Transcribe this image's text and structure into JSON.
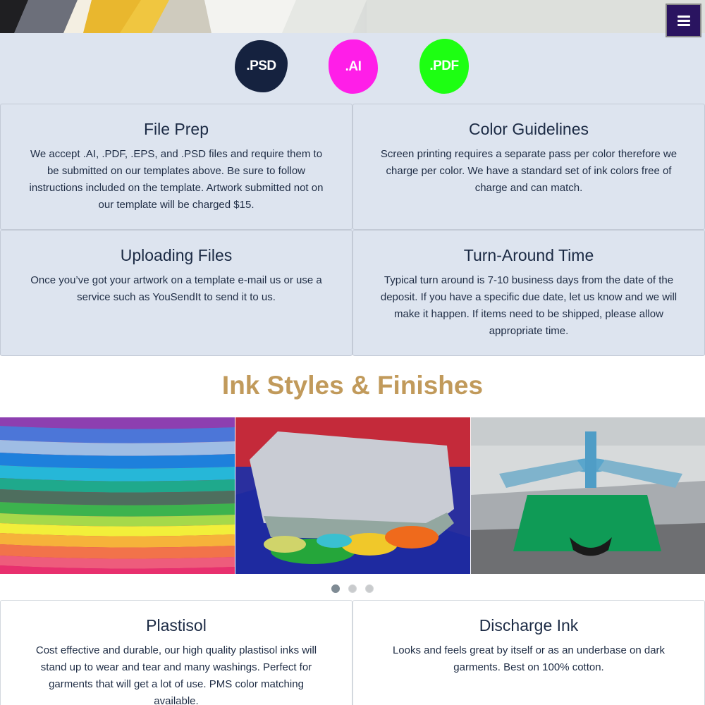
{
  "header": {
    "menu_icon": "hamburger-icon"
  },
  "file_types": [
    {
      "label": ".PSD",
      "color": "#15223f"
    },
    {
      "label": ".AI",
      "color": "#ff1ee8"
    },
    {
      "label": ".PDF",
      "color": "#1dff12"
    }
  ],
  "guidelines": [
    {
      "title": "File Prep",
      "body": "We accept .AI, .PDF, .EPS, and .PSD files and require them to be submitted on our templates above. Be sure to follow instructions included on the template. Artwork submitted not on our template will be charged $15."
    },
    {
      "title": "Color Guidelines",
      "body": "Screen printing requires a separate pass per color therefore we charge per color. We have a standard set of ink colors free of charge and can match."
    },
    {
      "title": "Uploading Files",
      "body": "Once you’ve got your artwork on a template e-mail us or use a service such as YouSendIt to send it to us."
    },
    {
      "title": "Turn-Around Time",
      "body": "Typical turn around is 7-10 business days from the date of the deposit. If you have a specific due date, let us know and we will make it happen. If items need to be shipped, please allow appropriate time."
    }
  ],
  "ink_section": {
    "title": "Ink Styles & Finishes",
    "accent_color": "#c19a5b",
    "carousel": {
      "slide_count": 3,
      "active_slide": 1
    },
    "styles": [
      {
        "title": "Plastisol",
        "body": "Cost effective and durable, our high quality plastisol inks will stand up to wear and tear and many washings. Perfect for garments that will get a lot of use. PMS color matching available."
      },
      {
        "title": "Discharge Ink",
        "body": "Looks and feels great by itself or as an underbase on dark garments. Best on 100% cotton."
      }
    ]
  }
}
